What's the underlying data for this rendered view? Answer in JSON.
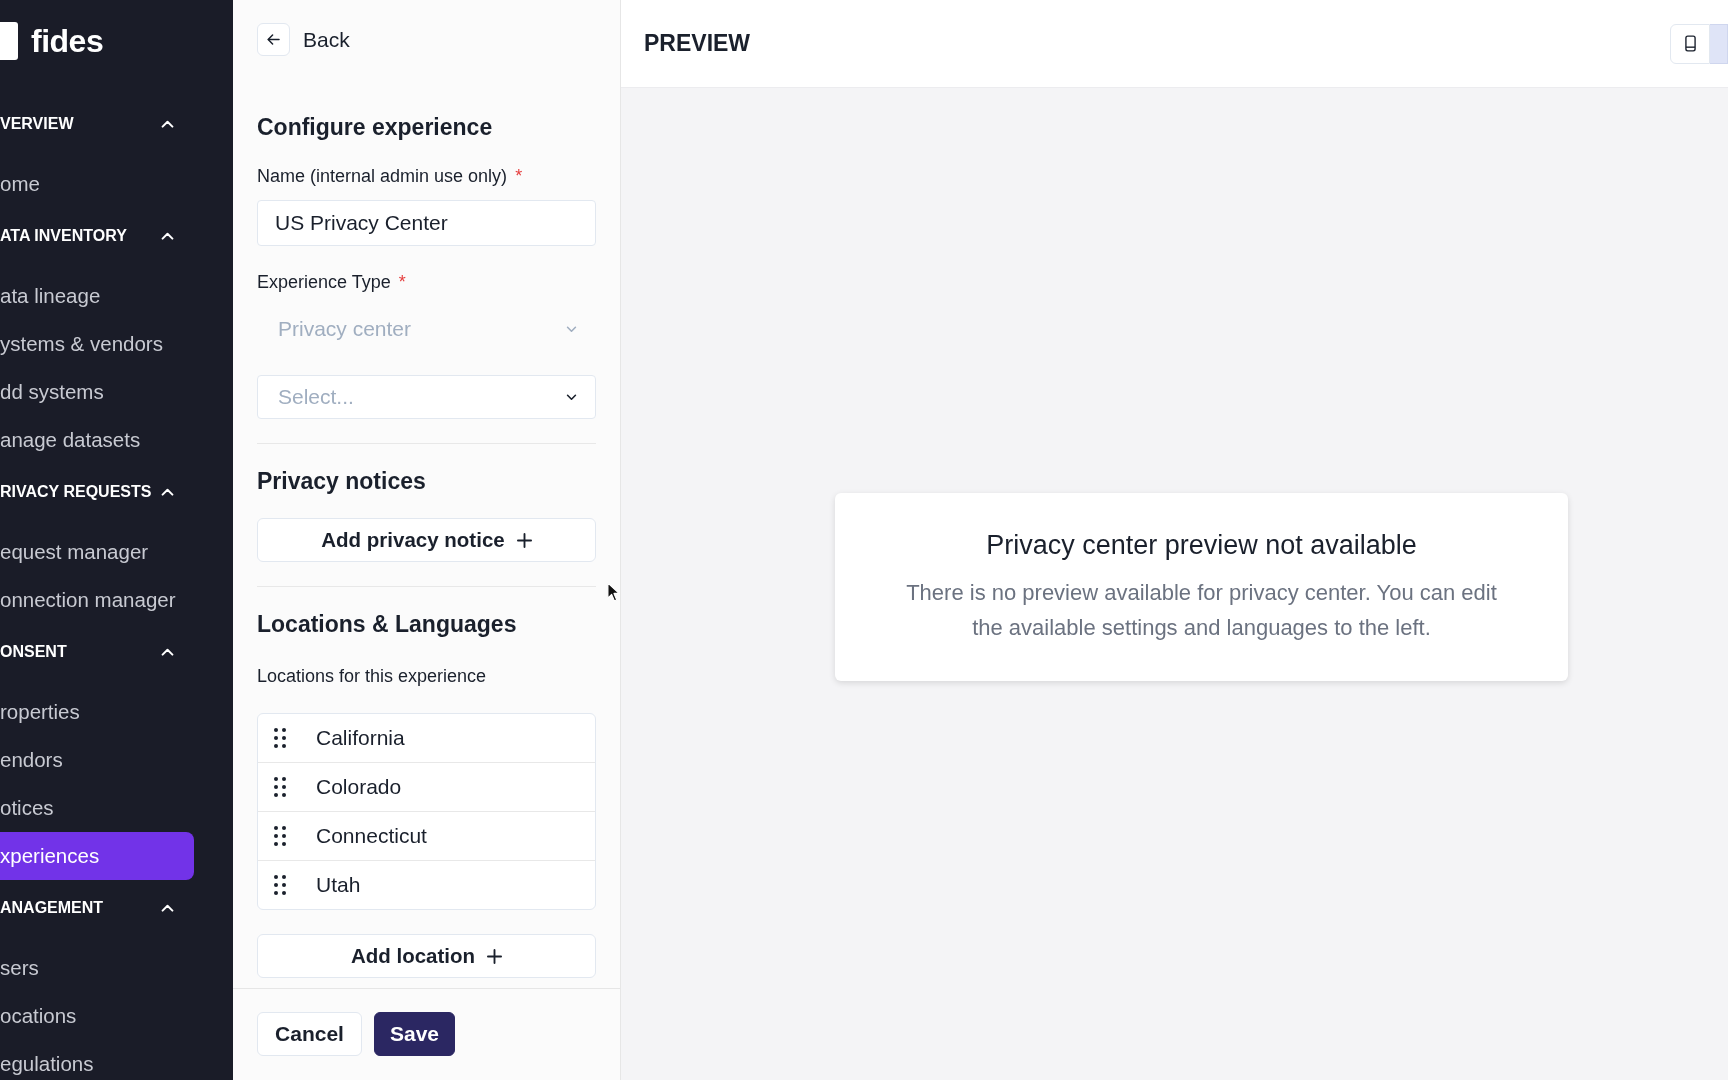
{
  "sidebar": {
    "logo": "fides",
    "sections": [
      {
        "title": "VERVIEW",
        "expanded": true,
        "items": [
          {
            "label": "ome",
            "selected": false
          }
        ]
      },
      {
        "title": "ATA INVENTORY",
        "expanded": true,
        "items": [
          {
            "label": "ata lineage",
            "selected": false
          },
          {
            "label": "ystems & vendors",
            "selected": false
          },
          {
            "label": "dd systems",
            "selected": false
          },
          {
            "label": "anage datasets",
            "selected": false
          }
        ]
      },
      {
        "title": "RIVACY REQUESTS",
        "expanded": true,
        "items": [
          {
            "label": "equest manager",
            "selected": false
          },
          {
            "label": "onnection manager",
            "selected": false
          }
        ]
      },
      {
        "title": "ONSENT",
        "expanded": true,
        "items": [
          {
            "label": "roperties",
            "selected": false
          },
          {
            "label": "endors",
            "selected": false
          },
          {
            "label": "otices",
            "selected": false
          },
          {
            "label": "xperiences",
            "selected": true
          }
        ]
      },
      {
        "title": "ANAGEMENT",
        "expanded": true,
        "items": [
          {
            "label": "sers",
            "selected": false
          },
          {
            "label": "ocations",
            "selected": false
          },
          {
            "label": "egulations",
            "selected": false
          }
        ]
      }
    ]
  },
  "form_panel": {
    "back": "Back",
    "title": "Configure experience",
    "fields": [
      {
        "kind": "text",
        "label": "Name (internal admin use only)",
        "required_mark": "*",
        "value": "US Privacy Center",
        "disabled": false
      },
      {
        "kind": "select",
        "label": "Experience Type",
        "required_mark": "*",
        "value": "Privacy center",
        "disabled": true
      },
      {
        "kind": "select",
        "placeholder": "Select...",
        "disabled": false
      }
    ],
    "sections": [
      {
        "title": "Privacy notices",
        "add_button": "Add privacy notice"
      },
      {
        "title": "Locations & Languages",
        "label": "Locations for this experience",
        "items": [
          "California",
          "Colorado",
          "Connecticut",
          "Utah"
        ],
        "add_button": "Add location"
      }
    ],
    "buttons": [
      {
        "kind": "secondary",
        "label": "Cancel"
      },
      {
        "kind": "primary",
        "label": "Save"
      }
    ]
  },
  "preview": {
    "title": "PREVIEW",
    "view_buttons": [
      {
        "kind": "phone",
        "selected": false
      },
      {
        "kind": "edge",
        "selected": true
      }
    ],
    "notice": {
      "title": "Privacy center preview not available",
      "message": "There is no preview available for privacy center. You can edit the available settings and languages to the left."
    }
  }
}
